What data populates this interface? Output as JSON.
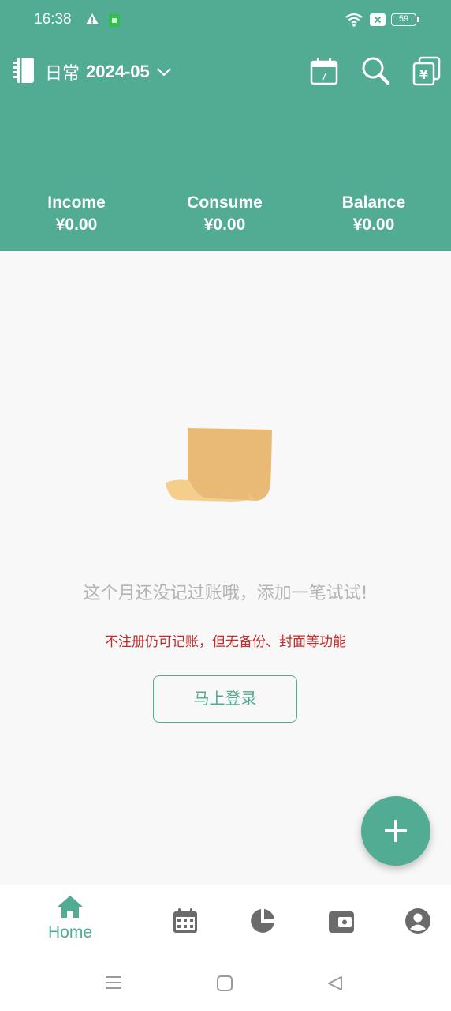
{
  "status_bar": {
    "time": "16:38",
    "battery": "59",
    "icons": [
      "warning-icon",
      "app-notification-icon",
      "wifi-icon",
      "sim-x-icon",
      "battery-icon"
    ]
  },
  "header": {
    "book_name": "日常",
    "month": "2024-05",
    "icons": [
      "ledger-book-icon",
      "chevron-down-icon",
      "calendar-icon",
      "search-icon",
      "bill-copy-icon"
    ],
    "calendar_day": "7",
    "background_color": "#52ab93"
  },
  "summary": [
    {
      "label": "Income",
      "value": "¥0.00"
    },
    {
      "label": "Consume",
      "value": "¥0.00"
    },
    {
      "label": "Balance",
      "value": "¥0.00"
    }
  ],
  "empty_state": {
    "message": "这个月还没记过账哦，添加一笔试试!",
    "note": "不注册仍可记账，但无备份、封面等功能",
    "login_button": "马上登录",
    "note_color": "#c62a2a"
  },
  "fab": {
    "icon": "plus-icon"
  },
  "bottom_nav": {
    "home_label": "Home",
    "icons": [
      "home-icon",
      "calendar-grid-icon",
      "pie-chart-icon",
      "wallet-icon",
      "account-icon"
    ],
    "active_color": "#52ab93"
  },
  "system_nav": {
    "icons": [
      "menu-icon",
      "home-square-icon",
      "back-triangle-icon"
    ]
  }
}
